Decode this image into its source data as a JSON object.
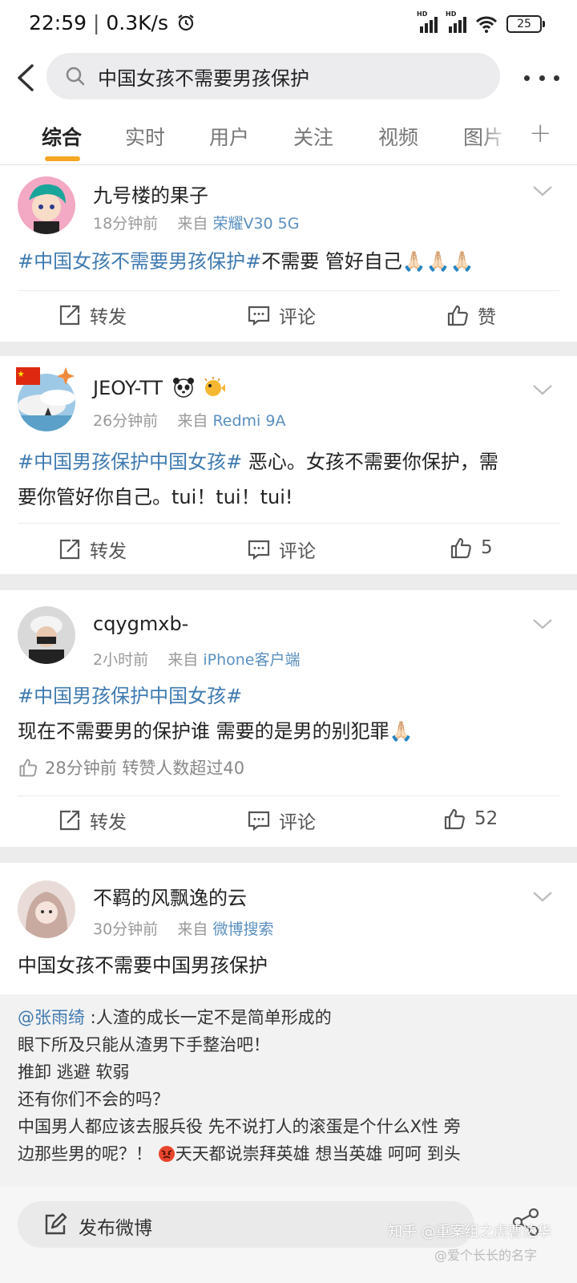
{
  "status_bar": {
    "time": "22:59",
    "network_speed": "0.3K/s",
    "signal_label": "HD",
    "battery": "25"
  },
  "search": {
    "query": "中国女孩不需要男孩保护"
  },
  "tabs": [
    "综合",
    "实时",
    "用户",
    "关注",
    "视频",
    "图片"
  ],
  "active_tab": "综合",
  "posts": [
    {
      "username": "九号楼的果子",
      "time": "18分钟前",
      "from": "来自",
      "source": "荣耀V30 5G",
      "hashtag": "#中国女孩不需要男孩保护#",
      "text": "不需要 管好自己",
      "emoji": "🙏🏻🙏🏻🙏🏻",
      "repost_label": "转发",
      "comment_label": "评论",
      "like_label": "赞"
    },
    {
      "username": "JEOY-TT",
      "time": "26分钟前",
      "from": "来自",
      "source": "Redmi 9A",
      "hashtag": "#中国男孩保护中国女孩#",
      "text_line1": " 恶心。女孩不需要你保护，需",
      "text_line2": "要你管好你自己。tui！tui！tui!",
      "repost_label": "转发",
      "comment_label": "评论",
      "like_count": "5"
    },
    {
      "username": "cqygmxb-",
      "time": "2小时前",
      "from": "来自",
      "source": "iPhone客户端",
      "hashtag": "#中国男孩保护中国女孩#",
      "text": "现在不需要男的保护谁 需要的是男的别犯罪",
      "emoji": "🙏🏻",
      "liked_note": "28分钟前 转赞人数超过40",
      "repost_label": "转发",
      "comment_label": "评论",
      "like_count": "52"
    },
    {
      "username": "不羁的风飘逸的云",
      "time": "30分钟前",
      "from": "来自",
      "source": "微博搜索",
      "text": "中国女孩不需要中国男孩保护"
    }
  ],
  "quote": {
    "mention": "@张雨绮",
    "line1": " :人渣的成长一定不是简单形成的",
    "line2": "眼下所及只能从渣男下手整治吧！",
    "line3": "推卸 逃避 软弱",
    "line4": "还有你们不会的吗？",
    "line5": "中国男人都应该去服兵役 先不说打人的滚蛋是个什么X性 旁",
    "line6a": "边那些男的呢？！",
    "line6b": "天天都说崇拜英雄 想当英雄 呵呵 到头"
  },
  "bottom_bar": {
    "compose_label": "发布微博",
    "watermark": "知乎 @重案组之虎曹达华",
    "watermark2": "@爱个长长的名字"
  },
  "colors": {
    "accent": "#f5a623",
    "link": "#3f7ab0",
    "background": "#ececec"
  }
}
